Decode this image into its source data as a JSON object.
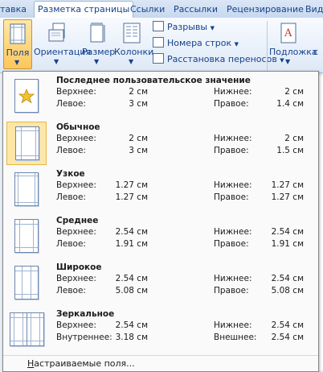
{
  "ribbon_tabs": {
    "t0": "тавка",
    "t1": "Разметка страницы",
    "t2": "Ссылки",
    "t3": "Рассылки",
    "t4": "Рецензирование",
    "t5": "Вид"
  },
  "ribbon": {
    "margins": "Поля",
    "orientation": "Ориентация",
    "size": "Размер",
    "columns": "Колонки",
    "breaks": "Разрывы",
    "line_numbers": "Номера строк",
    "hyphenation": "Расстановка переносов",
    "watermark": "Подложка",
    "right_cut": "с"
  },
  "margins_menu": {
    "items": [
      {
        "title": "Последнее пользовательское значение",
        "l1": "Верхнее:",
        "v1": "2 см",
        "l2": "Нижнее:",
        "v2": "2 см",
        "l3": "Левое:",
        "v3": "3 см",
        "l4": "Правое:",
        "v4": "1.4 см"
      },
      {
        "title": "Обычное",
        "l1": "Верхнее:",
        "v1": "2 см",
        "l2": "Нижнее:",
        "v2": "2 см",
        "l3": "Левое:",
        "v3": "3 см",
        "l4": "Правое:",
        "v4": "1.5 см"
      },
      {
        "title": "Узкое",
        "l1": "Верхнее:",
        "v1": "1.27 см",
        "l2": "Нижнее:",
        "v2": "1.27 см",
        "l3": "Левое:",
        "v3": "1.27 см",
        "l4": "Правое:",
        "v4": "1.27 см"
      },
      {
        "title": "Среднее",
        "l1": "Верхнее:",
        "v1": "2.54 см",
        "l2": "Нижнее:",
        "v2": "2.54 см",
        "l3": "Левое:",
        "v3": "1.91 см",
        "l4": "Правое:",
        "v4": "1.91 см"
      },
      {
        "title": "Широкое",
        "l1": "Верхнее:",
        "v1": "2.54 см",
        "l2": "Нижнее:",
        "v2": "2.54 см",
        "l3": "Левое:",
        "v3": "5.08 см",
        "l4": "Правое:",
        "v4": "5.08 см"
      },
      {
        "title": "Зеркальное",
        "l1": "Верхнее:",
        "v1": "2.54 см",
        "l2": "Нижнее:",
        "v2": "2.54 см",
        "l3": "Внутреннее:",
        "v3": "3.18 см",
        "l4": "Внешнее:",
        "v4": "2.54 см"
      }
    ],
    "selected_index": 1,
    "custom_hotkey": "Н",
    "custom_rest": "астраиваемые поля..."
  }
}
